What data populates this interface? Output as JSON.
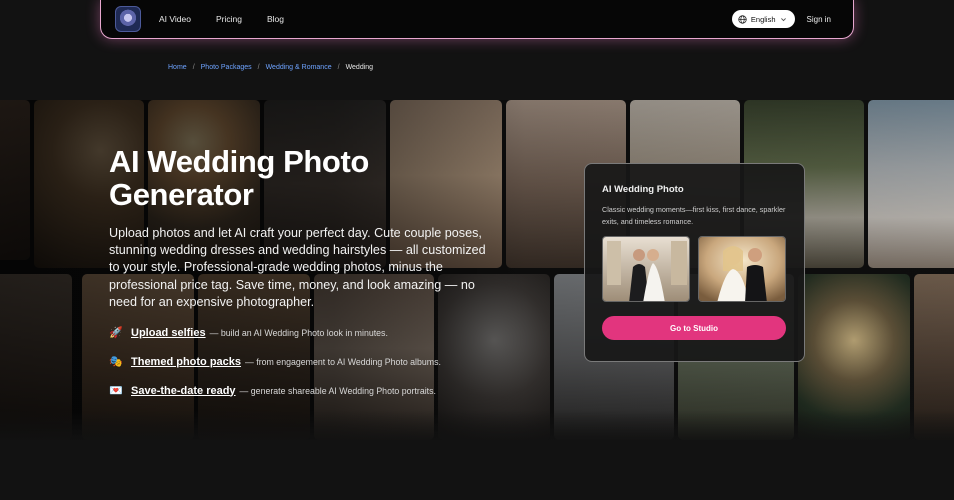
{
  "nav": {
    "logo_alt": "App logo",
    "links": [
      "AI Video",
      "Pricing",
      "Blog"
    ],
    "language": "English",
    "signin": "Sign in"
  },
  "breadcrumb": {
    "items": [
      "Home",
      "Photo Packages",
      "Wedding & Romance"
    ],
    "current": "Wedding"
  },
  "hero": {
    "title": "AI Wedding Photo Generator",
    "description": "Upload photos and let AI craft your perfect day. Cute couple poses, stunning wedding dresses and wedding hairstyles — all customized to your style. Professional-grade wedding photos, minus the professional price tag. Save time, money, and look amazing — no need for an expensive photographer.",
    "features": [
      {
        "icon": "rocket-icon",
        "emoji": "🚀",
        "strong": "Upload selfies",
        "text": "— build an AI Wedding Photo look in minutes."
      },
      {
        "icon": "masks-icon",
        "emoji": "🎭",
        "strong": "Themed photo packs",
        "text": "— from engagement to AI Wedding Photo albums."
      },
      {
        "icon": "heart-letter-icon",
        "emoji": "💌",
        "strong": "Save-the-date ready",
        "text": "— generate shareable AI Wedding Photo portraits."
      }
    ]
  },
  "card": {
    "title": "AI Wedding Photo",
    "description": "Classic wedding moments—first kiss, first dance, sparkler exits, and timeless romance.",
    "button": "Go to Studio"
  },
  "colors": {
    "accent": "#e2357e",
    "nav_glow": "#e7a7cf",
    "link": "#6ea3ff",
    "background": "#121212"
  }
}
